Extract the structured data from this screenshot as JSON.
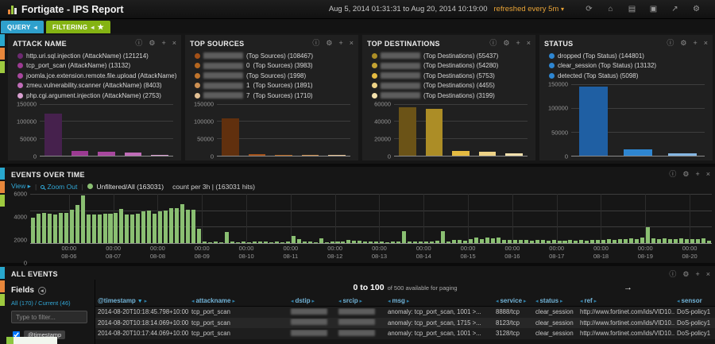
{
  "navbar": {
    "title": "Fortigate - IPS Report",
    "time_range": "Aug 5, 2014 01:31:31 to Aug 20, 2014 10:19:00",
    "refresh_label": "refreshed every 5m",
    "icons": [
      {
        "name": "refresh-icon",
        "glyph": "⟳"
      },
      {
        "name": "home-icon",
        "glyph": "⌂"
      },
      {
        "name": "load-dashboard-icon",
        "glyph": "▤"
      },
      {
        "name": "save-dashboard-icon",
        "glyph": "▣"
      },
      {
        "name": "share-icon",
        "glyph": "↗"
      },
      {
        "name": "settings-icon",
        "glyph": "⚙"
      }
    ]
  },
  "querybar": {
    "query_label": "QUERY",
    "filtering_label": "FILTERING",
    "collapse_arrow": "◂",
    "star": "★"
  },
  "panel_header_icons": [
    {
      "name": "info-icon",
      "glyph": "ⓘ"
    },
    {
      "name": "configure-icon",
      "glyph": "⚙"
    },
    {
      "name": "move-icon",
      "glyph": "+"
    },
    {
      "name": "close-icon",
      "glyph": "×"
    }
  ],
  "panels": [
    {
      "title": "ATTACK NAME",
      "legend": [
        {
          "redacted": false,
          "text": "http.uri.sql.injection (AttackName) (121214)",
          "color": "#6d2a71"
        },
        {
          "redacted": false,
          "text": "tcp_port_scan (AttackName) (13132)",
          "color": "#9c3a92"
        },
        {
          "redacted": false,
          "text": "joomla.jce.extension.remote.file.upload (AttackName) (11126)",
          "color": "#a8479e"
        },
        {
          "redacted": false,
          "text": "zmeu.vulnerability.scanner (AttackName) (8403)",
          "color": "#c06cb8"
        },
        {
          "redacted": false,
          "text": "php.cgi.argument.injection (AttackName) (2753)",
          "color": "#d9a0d1"
        }
      ],
      "chart": {
        "type": "bar",
        "ymax": 150000,
        "yticks": [
          "150000",
          "100000",
          "50000",
          "0"
        ],
        "values": [
          121214,
          13132,
          11126,
          8403,
          2753
        ],
        "colors": [
          "#46214d",
          "#9c3a92",
          "#a8479e",
          "#c06cb8",
          "#d9a0d1"
        ]
      }
    },
    {
      "title": "TOP SOURCES",
      "legend": [
        {
          "redacted": true,
          "suffix": "",
          "text": "(Top Sources) (108467)",
          "color": "#a35017"
        },
        {
          "redacted": true,
          "suffix": "0",
          "text": "(Top Sources) (3983)",
          "color": "#b4651e"
        },
        {
          "redacted": true,
          "suffix": "",
          "text": "(Top Sources) (1998)",
          "color": "#c0742c"
        },
        {
          "redacted": true,
          "suffix": "1",
          "text": "(Top Sources) (1891)",
          "color": "#cd9052"
        },
        {
          "redacted": true,
          "suffix": "7",
          "text": "(Top Sources) (1710)",
          "color": "#e3c094"
        }
      ],
      "chart": {
        "type": "bar",
        "ymax": 150000,
        "yticks": [
          "150000",
          "100000",
          "50000",
          "0"
        ],
        "values": [
          108467,
          3983,
          1998,
          1891,
          1710
        ],
        "colors": [
          "#61300e",
          "#a35017",
          "#b4651e",
          "#cd9052",
          "#e3c094"
        ]
      }
    },
    {
      "title": "TOP DESTINATIONS",
      "legend": [
        {
          "redacted": true,
          "suffix": "",
          "text": "(Top Destinations) (55437)",
          "color": "#ac8d26"
        },
        {
          "redacted": true,
          "suffix": "",
          "text": "(Top Destinations) (54280)",
          "color": "#c4a332"
        },
        {
          "redacted": true,
          "suffix": "",
          "text": "(Top Destinations) (5753)",
          "color": "#e5bb41"
        },
        {
          "redacted": true,
          "suffix": "",
          "text": "(Top Destinations) (4455)",
          "color": "#edd286"
        },
        {
          "redacted": true,
          "suffix": "",
          "text": "(Top Destinations) (3199)",
          "color": "#f3e1ad"
        }
      ],
      "chart": {
        "type": "bar",
        "ymax": 60000,
        "yticks": [
          "60000",
          "40000",
          "20000",
          "0"
        ],
        "values": [
          55437,
          54280,
          5753,
          4455,
          3199
        ],
        "colors": [
          "#6b5317",
          "#ac8d26",
          "#e5bb41",
          "#edd286",
          "#f3e1ad"
        ]
      }
    },
    {
      "title": "STATUS",
      "legend": [
        {
          "redacted": false,
          "text": "dropped (Top Status) (144801)",
          "color": "#2e86d1"
        },
        {
          "redacted": false,
          "text": "clear_session (Top Status) (13132)",
          "color": "#2e86d1"
        },
        {
          "redacted": false,
          "text": "detected (Top Status) (5098)",
          "color": "#2e86d1"
        }
      ],
      "chart": {
        "type": "bar",
        "ymax": 150000,
        "yticks": [
          "150000",
          "100000",
          "50000",
          "0"
        ],
        "values": [
          144801,
          13132,
          5098
        ],
        "colors": [
          "#1f5fa3",
          "#2e86d1",
          "#85b6e2"
        ]
      }
    }
  ],
  "events": {
    "title": "EVENTS OVER TIME",
    "toolbar": {
      "view": "View",
      "view_arrow": "▸",
      "zoom_out": "Zoom Out",
      "query_legend": "Unfiltered/All (163031)",
      "interval_note": "count per 3h | (163031 hits)"
    },
    "chart": {
      "type": "bar",
      "ymax": 6000,
      "yticks": [
        "6000",
        "4000",
        "2000",
        "0"
      ],
      "bar_color": "#8abf72",
      "time_tick_label": "00:00",
      "day_labels": [
        "08-06",
        "08-07",
        "08-08",
        "08-09",
        "08-10",
        "08-11",
        "08-12",
        "08-13",
        "08-14",
        "08-15",
        "08-16",
        "08-17",
        "08-18",
        "08-19",
        "08-20"
      ],
      "first_day_bar_count": 7,
      "bars_per_day": 8,
      "values": [
        3100,
        3600,
        3700,
        3600,
        3500,
        3650,
        3700,
        4100,
        4600,
        5800,
        3500,
        3450,
        3500,
        3550,
        3600,
        3700,
        4150,
        3500,
        3450,
        3550,
        3900,
        3950,
        3600,
        3900,
        4000,
        4250,
        4300,
        4700,
        4100,
        4050,
        1700,
        150,
        120,
        180,
        140,
        1400,
        160,
        130,
        150,
        130,
        160,
        200,
        150,
        130,
        170,
        140,
        150,
        900,
        500,
        150,
        200,
        130,
        600,
        140,
        150,
        150,
        180,
        400,
        250,
        300,
        200,
        150,
        160,
        160,
        140,
        180,
        150,
        1500,
        170,
        160,
        200,
        180,
        150,
        250,
        1500,
        200,
        350,
        400,
        300,
        500,
        700,
        450,
        650,
        550,
        650,
        400,
        350,
        350,
        400,
        350,
        300,
        400,
        350,
        300,
        350,
        250,
        300,
        350,
        300,
        350,
        300,
        400,
        350,
        400,
        450,
        400,
        500,
        450,
        550,
        450,
        700,
        1900,
        550,
        500,
        550,
        450,
        500,
        550,
        450,
        450,
        500,
        550,
        300
      ]
    }
  },
  "all_events": {
    "title": "ALL EVENTS",
    "fields": {
      "title": "Fields",
      "summary_links": "All (170) / Current (46)",
      "filter_placeholder": "Type to filter...",
      "selected_field": "@timestamp"
    },
    "paging": {
      "range": "0 to 100",
      "note": "of 500 available for paging",
      "next_arrow": "→"
    },
    "table": {
      "columns": [
        "@timestamp",
        "attackname",
        "dstip",
        "srcip",
        "msg",
        "service",
        "status",
        "ref",
        "sensor"
      ],
      "redacted_columns": [
        "dstip",
        "srcip"
      ],
      "rows": [
        {
          "timestamp": "2014-08-20T10:18:45.798+10:00",
          "attackname": "tcp_port_scan",
          "msg": "anomaly: tcp_port_scan, 1001 >...",
          "service": "8888/tcp",
          "status": "clear_session",
          "ref": "http://www.fortinet.com/ids/VID10...",
          "sensor": "DoS-policy1"
        },
        {
          "timestamp": "2014-08-20T10:18:14.069+10:00",
          "attackname": "tcp_port_scan",
          "msg": "anomaly: tcp_port_scan, 1715 >...",
          "service": "8123/tcp",
          "status": "clear_session",
          "ref": "http://www.fortinet.com/ids/VID10...",
          "sensor": "DoS-policy1"
        },
        {
          "timestamp": "2014-08-20T10:17:44.069+10:00",
          "attackname": "tcp_port_scan",
          "msg": "anomaly: tcp_port_scan, 1001 >...",
          "service": "3128/tcp",
          "status": "clear_session",
          "ref": "http://www.fortinet.com/ids/VID10...",
          "sensor": "DoS-policy1"
        }
      ]
    }
  },
  "colors": {
    "accent_blue": "#31a7d6",
    "accent_orange": "#e8873b",
    "accent_green": "#9eca3f",
    "refresh_link": "#e9a437",
    "histogram_green": "#8abf72"
  }
}
